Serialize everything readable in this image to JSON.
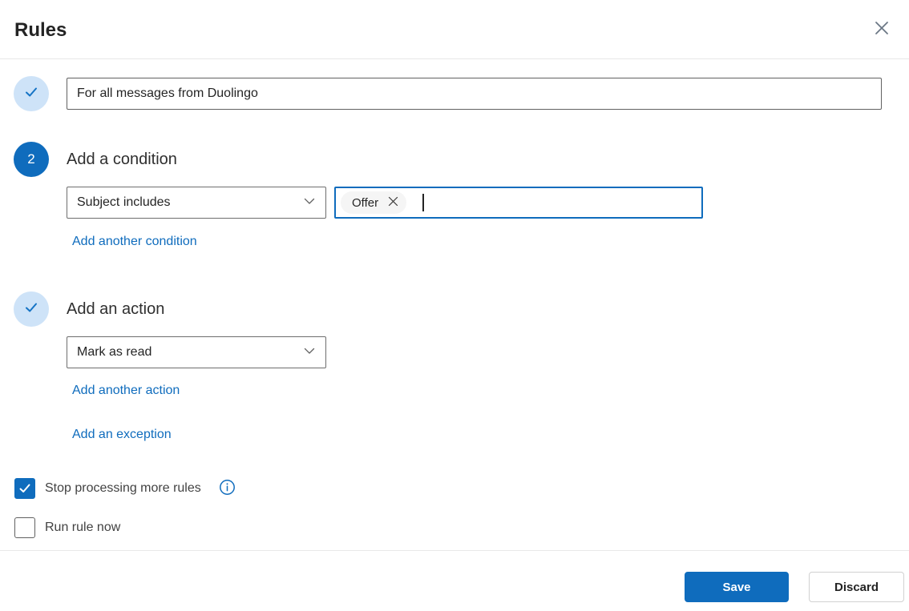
{
  "dialog": {
    "title": "Rules"
  },
  "steps": {
    "name": {
      "value": "For all messages from Duolingo"
    },
    "condition": {
      "number": "2",
      "heading": "Add a condition",
      "dropdown_value": "Subject includes",
      "tag": "Offer",
      "add_link": "Add another condition"
    },
    "action": {
      "heading": "Add an action",
      "dropdown_value": "Mark as read",
      "add_link": "Add another action",
      "exception_link": "Add an exception"
    }
  },
  "options": {
    "stop_processing": {
      "label": "Stop processing more rules",
      "checked": true
    },
    "run_now": {
      "label": "Run rule now",
      "checked": false
    }
  },
  "footer": {
    "save_label": "Save",
    "discard_label": "Discard"
  },
  "colors": {
    "primary": "#0f6cbd",
    "badge_light": "#cee3f8",
    "link": "#0f6cbd"
  }
}
